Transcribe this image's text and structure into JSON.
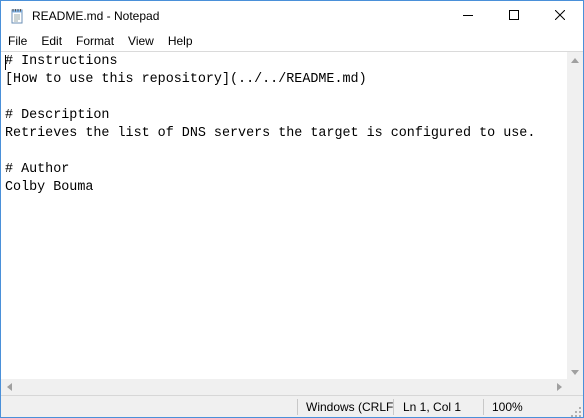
{
  "window": {
    "title": "README.md - Notepad",
    "accent_color": "#4a90d9",
    "icons": {
      "app": "notepad-icon",
      "minimize": "minimize-icon",
      "maximize": "maximize-icon",
      "close": "close-icon"
    }
  },
  "menu": {
    "items": [
      "File",
      "Edit",
      "Format",
      "View",
      "Help"
    ]
  },
  "editor": {
    "content": "# Instructions\n[How to use this repository](../../README.md)\n\n# Description\nRetrieves the list of DNS servers the target is configured to use.\n\n# Author\nColby Bouma"
  },
  "status": {
    "encoding": "Windows (CRLF",
    "position": "Ln 1, Col 1",
    "zoom": "100%"
  }
}
